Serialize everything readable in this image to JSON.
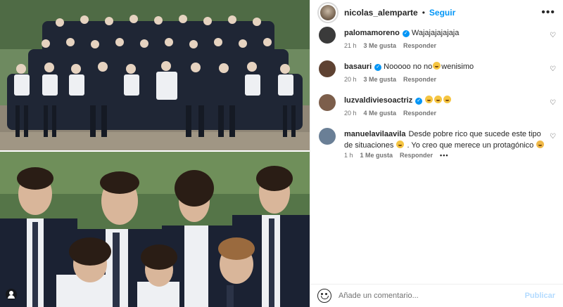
{
  "header": {
    "username": "nicolas_alemparte",
    "separator": "•",
    "follow_label": "Seguir",
    "more_icon": "more-horizontal-icon"
  },
  "comments": [
    {
      "user": "palomamoreno",
      "verified": true,
      "text": "Wajajajajajaja",
      "time": "21 h",
      "likes": "3 Me gusta",
      "reply": "Responder",
      "avatar_color": "#3a3a3a"
    },
    {
      "user": "basauri",
      "verified": true,
      "text_before": "Nooooo no no",
      "text_after": "wenisimo",
      "time": "20 h",
      "likes": "3 Me gusta",
      "reply": "Responder",
      "avatar_color": "#5e4232"
    },
    {
      "user": "luzvaldiviesoactriz",
      "verified": true,
      "text": "",
      "time": "20 h",
      "likes": "4 Me gusta",
      "reply": "Responder",
      "avatar_color": "#7c5e4b"
    },
    {
      "user": "manuelavilaavila",
      "verified": false,
      "text_before": "Desde pobre rico que sucede este tipo de situaciones",
      "text_after": ". Yo creo que merece un protagónico",
      "time": "1 h",
      "likes": "1 Me gusta",
      "reply": "Responder",
      "avatar_color": "#6a7f96"
    }
  ],
  "footer": {
    "placeholder": "Añade un comentario...",
    "publish_label": "Publicar"
  },
  "colors": {
    "accent": "#0095f6",
    "publish_disabled": "#b3dbff",
    "muted": "#737373"
  }
}
